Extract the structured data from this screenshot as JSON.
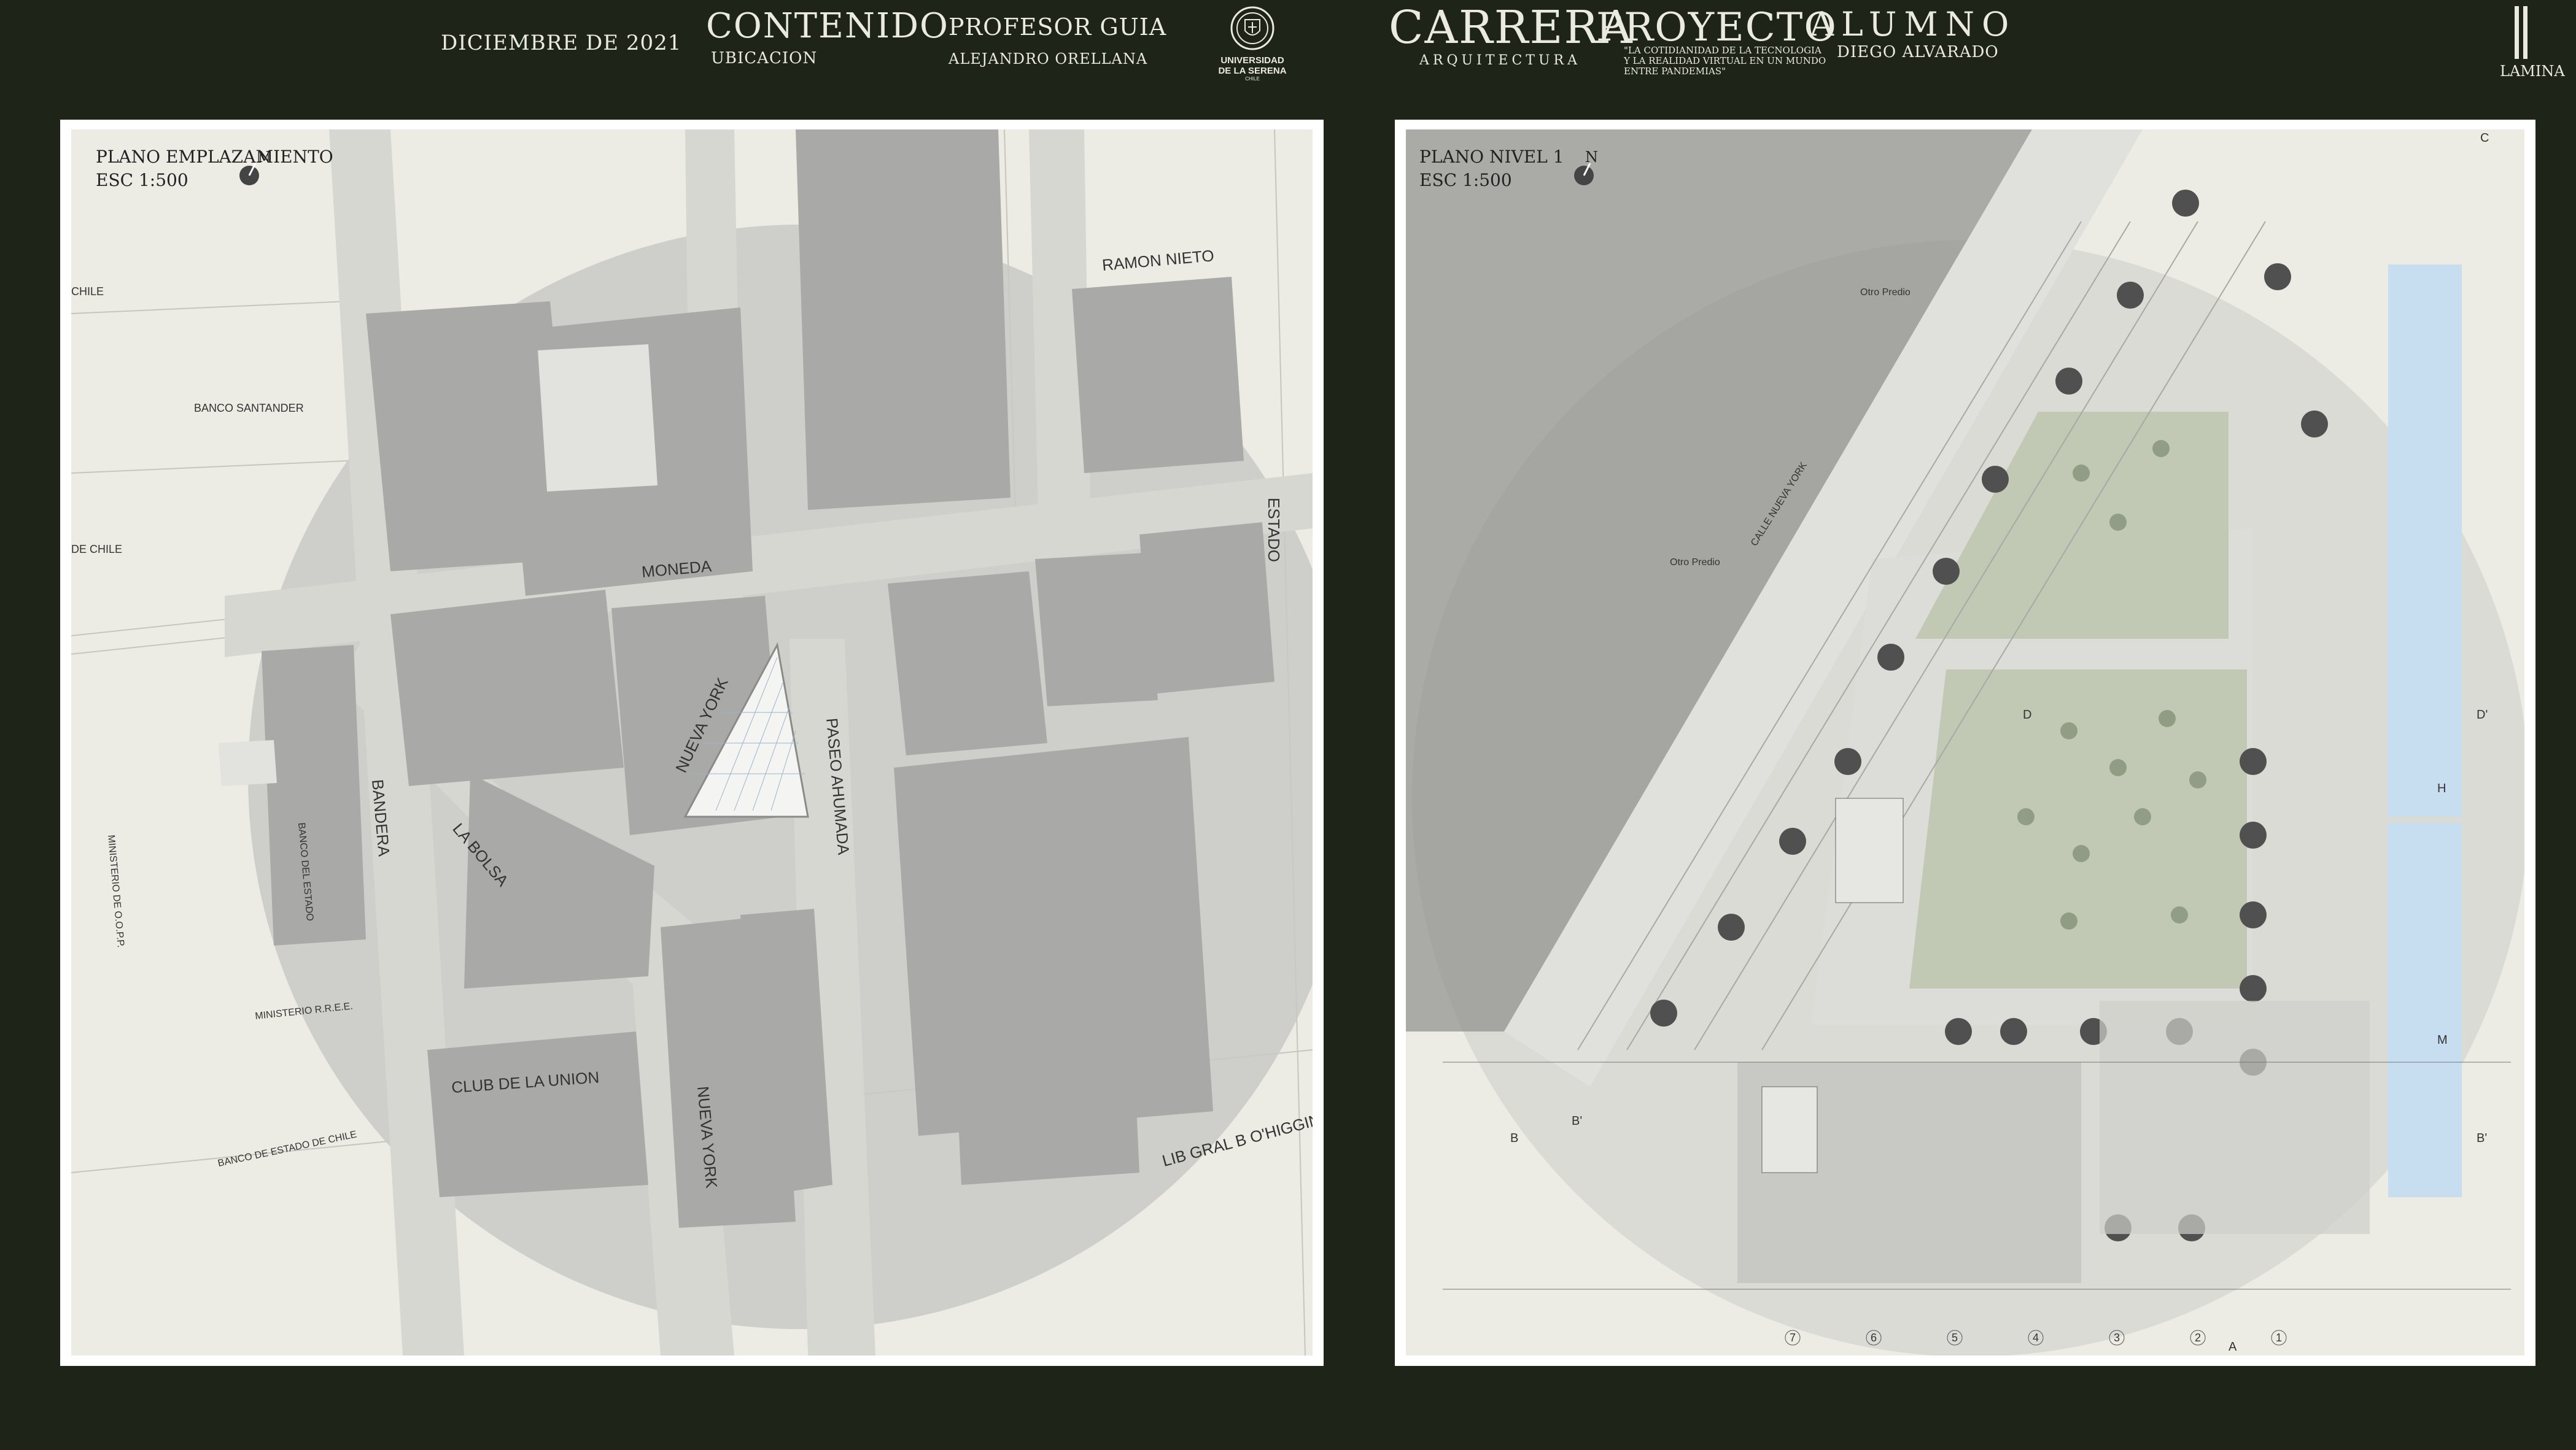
{
  "header": {
    "date": "DICIEMBRE  DE 2021",
    "contenido_title": "CONTENIDO",
    "contenido_value": "UBICACION",
    "profesor_title": "PROFESOR GUIA",
    "profesor_value": "ALEJANDRO ORELLANA",
    "university_line1": "UNIVERSIDAD",
    "university_line2": "DE LA SERENA",
    "university_line3": "CHILE",
    "carrera_title": "CARRERA",
    "carrera_value": "ARQUITECTURA",
    "proyecto_title": "PROYECTO",
    "proyecto_line1": "\"LA COTIDIANIDAD DE LA TECNOLOGIA",
    "proyecto_line2": "Y LA REALIDAD VIRTUAL EN UN MUNDO",
    "proyecto_line3": "ENTRE PANDEMIAS\"",
    "alumno_title": "ALUMNO",
    "alumno_value": "DIEGO ALVARADO",
    "lamina_label": "LAMINA"
  },
  "left_panel": {
    "title": "PLANO EMPLAZAMIENTO",
    "scale": "ESC 1:500",
    "north": "N",
    "streets": {
      "moneda": "MONEDA",
      "ramon_nieto": "RAMON NIETO",
      "estado": "ESTADO",
      "bandera": "BANDERA",
      "nueva_york_1": "NUEVA YORK",
      "nueva_york_2": "NUEVA YORK",
      "paseo_ahumada": "PASEO AHUMADA",
      "lib_gral": "LIB GRAL B O'HIGGINS",
      "chile": "CHILE",
      "de_chile": "DE CHILE"
    },
    "buildings": {
      "banco_santander": "BANCO SANTANDER",
      "la_bolsa": "LA BOLSA",
      "club_union": "CLUB DE LA UNION",
      "banco_estado": "BANCO DEL ESTADO",
      "ministerio_oopp": "MINISTERIO DE O.O.P.P.",
      "ministerio_rree": "MINISTERIO R.R.E.E.",
      "banco_estado_chile": "BANCO DE ESTADO DE CHILE"
    }
  },
  "right_panel": {
    "title": "PLANO NIVEL 1",
    "scale": "ESC 1:500",
    "north": "N",
    "labels": {
      "otro_predio_1": "Otro Predio",
      "otro_predio_2": "Otro Predio",
      "calle": "CALLE NUEVA YORK",
      "b_left": "B",
      "b_right": "B'",
      "d_right": "D'",
      "d_inner": "D",
      "b_inner": "B'",
      "c_right": "C",
      "h_right": "H",
      "m_right": "M",
      "a_bottom": "A"
    },
    "axis_numbers": [
      "7",
      "6",
      "5",
      "4",
      "3",
      "2",
      "1"
    ]
  }
}
